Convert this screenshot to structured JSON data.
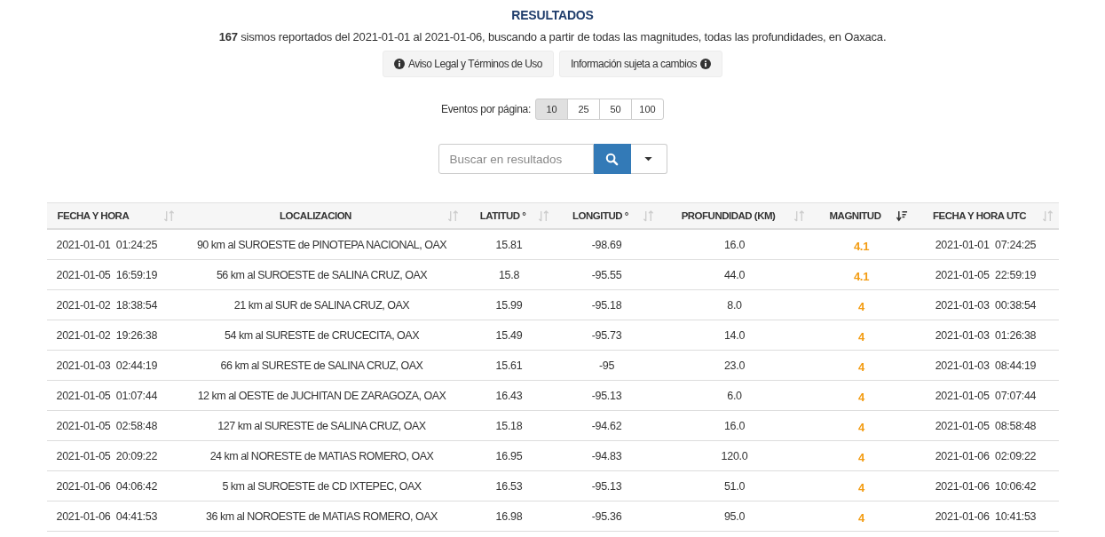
{
  "title": "RESULTADOS",
  "summary": "**167** sismos reportados del 2021-01-01 al 2021-01-06, buscando a partir de todas las magnitudes, todas las profundidades, en Oaxaca.",
  "notice_buttons": [
    {
      "label": "Aviso Legal y Términos de Uso",
      "kind": "leading-icon"
    },
    {
      "label": "Información sujeta a cambios",
      "kind": "trailing-icon"
    }
  ],
  "page_size": {
    "label": "Eventos por página:",
    "options": [
      {
        "label": "10",
        "selected": true
      },
      {
        "label": "25",
        "selected": false
      },
      {
        "label": "50",
        "selected": false
      },
      {
        "label": "100",
        "selected": false
      }
    ]
  },
  "search": {
    "placeholder": "Buscar en resultados"
  },
  "table": {
    "columns": [
      {
        "label": "FECHA Y HORA",
        "sorted": false
      },
      {
        "label": "LOCALIZACION",
        "sorted": false
      },
      {
        "label": "LATITUD °",
        "sorted": false
      },
      {
        "label": "LONGITUD °",
        "sorted": false
      },
      {
        "label": "PROFUNDIDAD (KM)",
        "sorted": false
      },
      {
        "label": "MAGNITUD",
        "sorted": true
      },
      {
        "label": "FECHA Y HORA UTC",
        "sorted": false
      }
    ],
    "rows": [
      [
        "2021-01-01  01:24:25",
        "90 km al SUROESTE de PINOTEPA NACIONAL, OAX",
        "15.81",
        "-98.69",
        "16.0",
        "4.1",
        "2021-01-01  07:24:25"
      ],
      [
        "2021-01-05  16:59:19",
        "56 km al SUROESTE de SALINA CRUZ, OAX",
        "15.8",
        "-95.55",
        "44.0",
        "4.1",
        "2021-01-05  22:59:19"
      ],
      [
        "2021-01-02  18:38:54",
        "21 km al SUR de SALINA CRUZ, OAX",
        "15.99",
        "-95.18",
        "8.0",
        "4",
        "2021-01-03  00:38:54"
      ],
      [
        "2021-01-02  19:26:38",
        "54 km al SURESTE de CRUCECITA, OAX",
        "15.49",
        "-95.73",
        "14.0",
        "4",
        "2021-01-03  01:26:38"
      ],
      [
        "2021-01-03  02:44:19",
        "66 km al SURESTE de SALINA CRUZ, OAX",
        "15.61",
        "-95",
        "23.0",
        "4",
        "2021-01-03  08:44:19"
      ],
      [
        "2021-01-05  01:07:44",
        "12 km al OESTE de JUCHITAN DE ZARAGOZA, OAX",
        "16.43",
        "-95.13",
        "6.0",
        "4",
        "2021-01-05  07:07:44"
      ],
      [
        "2021-01-05  02:58:48",
        "127 km al SURESTE de SALINA CRUZ, OAX",
        "15.18",
        "-94.62",
        "16.0",
        "4",
        "2021-01-05  08:58:48"
      ],
      [
        "2021-01-05  20:09:22",
        "24 km al NORESTE de MATIAS ROMERO, OAX",
        "16.95",
        "-94.83",
        "120.0",
        "4",
        "2021-01-06  02:09:22"
      ],
      [
        "2021-01-06  04:06:42",
        "5 km al SUROESTE de CD IXTEPEC, OAX",
        "16.53",
        "-95.13",
        "51.0",
        "4",
        "2021-01-06  10:06:42"
      ],
      [
        "2021-01-06  04:41:53",
        "36 km al NOROESTE de MATIAS ROMERO, OAX",
        "16.98",
        "-95.36",
        "95.0",
        "4",
        "2021-01-06  10:41:53"
      ]
    ]
  }
}
